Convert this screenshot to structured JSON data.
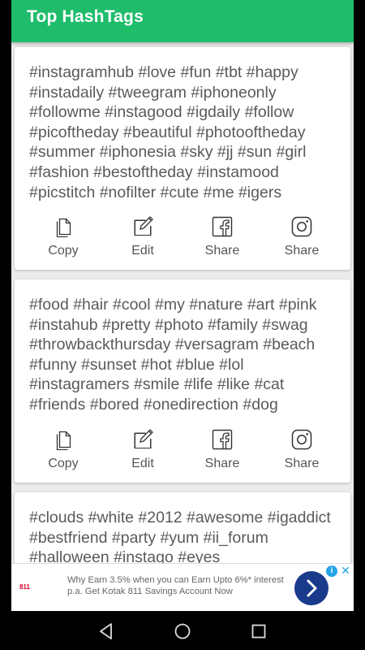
{
  "app": {
    "title": "Top HashTags"
  },
  "cards": [
    {
      "tags": "#instagramhub #love #fun #tbt #happy #instadaily #tweegram #iphoneonly #followme #instagood #igdaily #follow #picoftheday #beautiful #photooftheday #summer #iphonesia #sky #jj #sun #girl #fashion #bestoftheday #instamood #picstitch #nofilter #cute #me #igers",
      "actions": {
        "copy": "Copy",
        "edit": "Edit",
        "share_facebook": "Share",
        "share_instagram": "Share"
      }
    },
    {
      "tags": "#food #hair #cool #my #nature #art #pink #instahub #pretty #photo #family #swag #throwbackthursday #versagram #beach #funny #sunset #hot #blue #lol #instagramers #smile #life #like #cat #friends #bored #onedirection #dog",
      "actions": {
        "copy": "Copy",
        "edit": "Edit",
        "share_facebook": "Share",
        "share_instagram": "Share"
      }
    },
    {
      "tags": "#clouds #white #2012 #awesome #igaddict #bestfriend #party #yum #ii_forum #halloween #instago #eyes"
    }
  ],
  "ad": {
    "text": "Why Earn 3.5% when you can Earn Upto 6%* interest p.a. Get Kotak 811 Savings Account Now",
    "logo_text": "811",
    "info_glyph": "i",
    "close_glyph": "✕"
  },
  "icons": {
    "copy": "copy-icon",
    "edit": "edit-icon",
    "facebook": "facebook-icon",
    "instagram": "instagram-icon",
    "back": "back-icon",
    "home": "home-icon",
    "recents": "recents-icon"
  },
  "colors": {
    "app_bar": "#1fbd6b",
    "background": "#ececec",
    "card": "#ffffff",
    "tag_text": "#5a5a5a",
    "ad_button": "#1a3a8c"
  }
}
